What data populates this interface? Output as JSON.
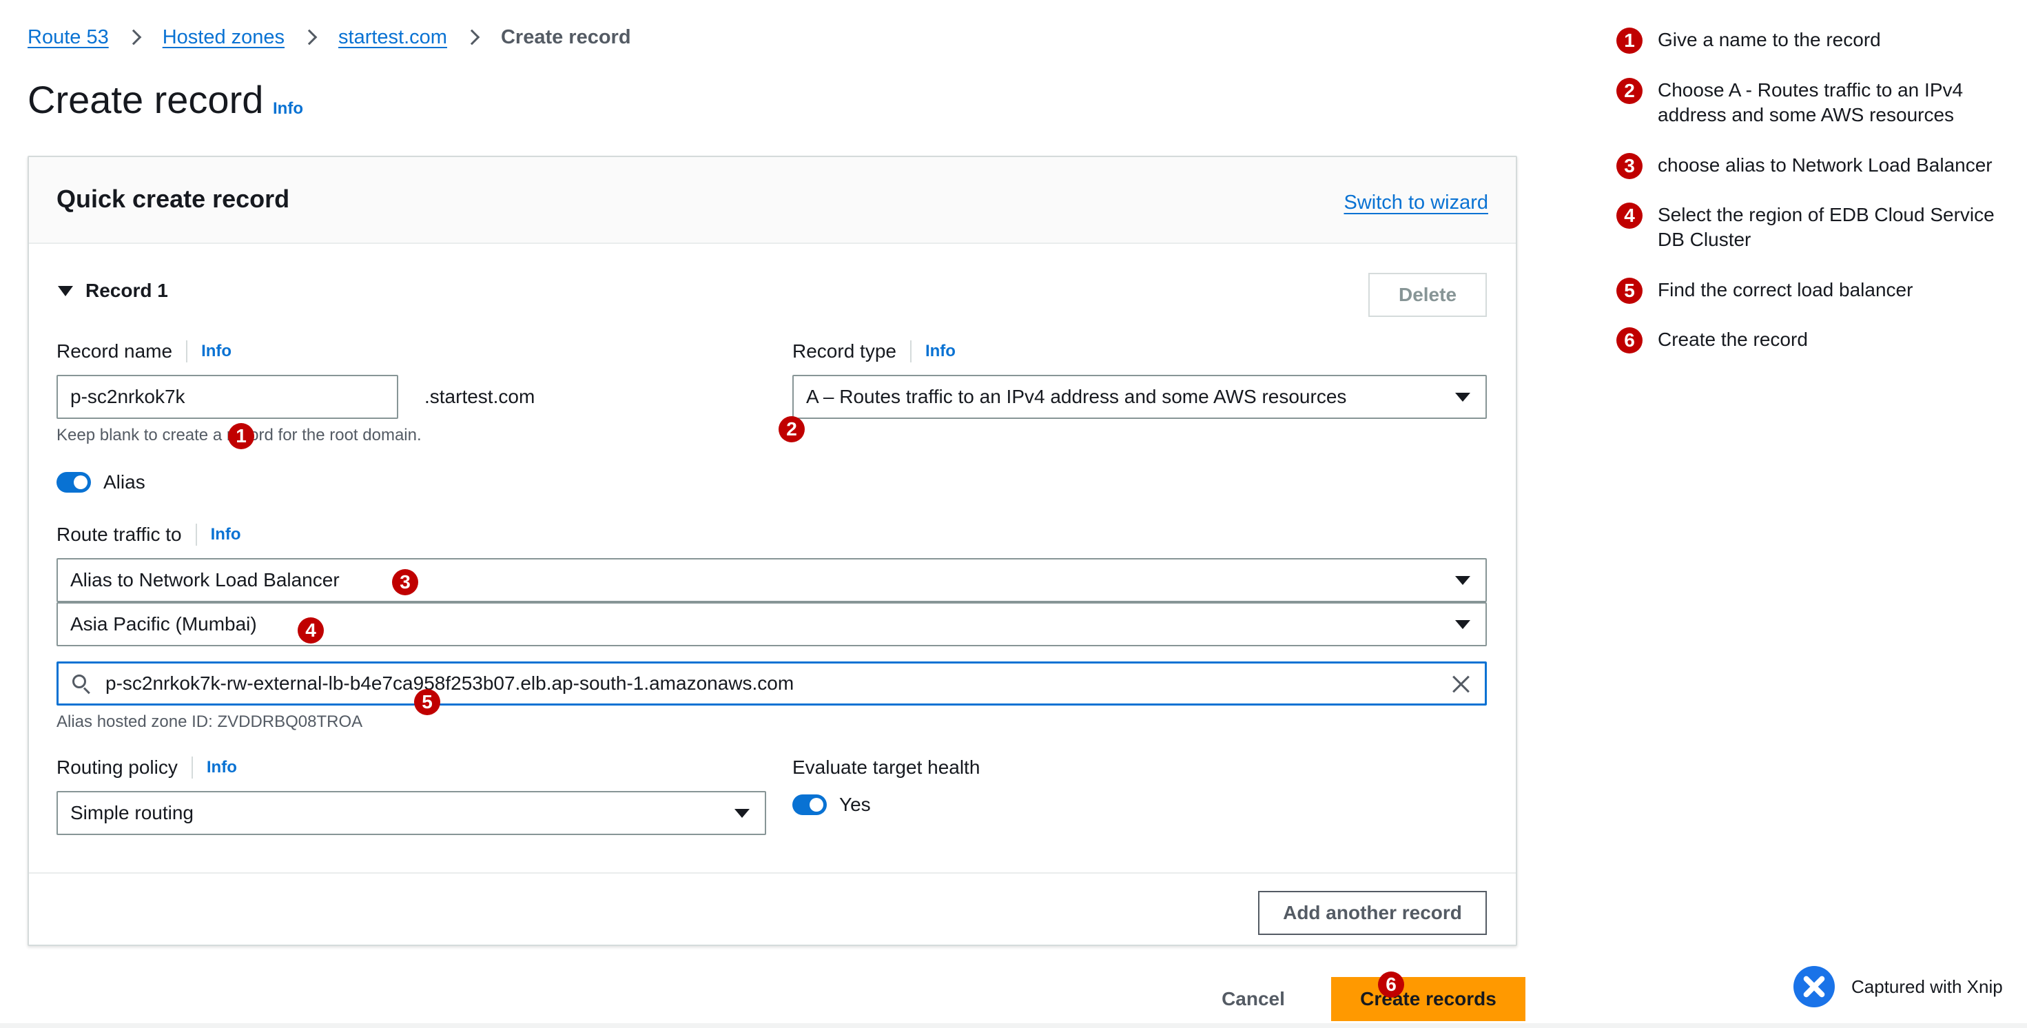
{
  "breadcrumb": {
    "items": [
      "Route 53",
      "Hosted zones",
      "startest.com"
    ],
    "current": "Create record"
  },
  "page": {
    "title": "Create record",
    "info": "Info"
  },
  "quick_create": {
    "title": "Quick create record",
    "switch_link": "Switch to wizard",
    "record_section": "Record 1",
    "delete_label": "Delete"
  },
  "record_name": {
    "label": "Record name",
    "info": "Info",
    "value": "p-sc2nrkok7k",
    "suffix": ".startest.com",
    "hint": "Keep blank to create a record for the root domain."
  },
  "record_type": {
    "label": "Record type",
    "info": "Info",
    "value": "A – Routes traffic to an IPv4 address and some AWS resources"
  },
  "alias": {
    "label": "Alias",
    "enabled": true
  },
  "route_traffic": {
    "label": "Route traffic to",
    "info": "Info",
    "endpoint": "Alias to Network Load Balancer",
    "region": "Asia Pacific (Mumbai)",
    "load_balancer": "p-sc2nrkok7k-rw-external-lb-b4e7ca958f253b07.elb.ap-south-1.amazonaws.com",
    "hosted_zone_hint": "Alias hosted zone ID: ZVDDRBQ08TROA"
  },
  "routing_policy": {
    "label": "Routing policy",
    "info": "Info",
    "value": "Simple routing"
  },
  "evaluate_health": {
    "label": "Evaluate target health",
    "toggle_label": "Yes",
    "enabled": true
  },
  "actions": {
    "add_another": "Add another record",
    "cancel": "Cancel",
    "create": "Create records"
  },
  "markers": [
    "1",
    "2",
    "3",
    "4",
    "5",
    "6"
  ],
  "steps": [
    {
      "num": "1",
      "text": "Give a name to the record"
    },
    {
      "num": "2",
      "text": "Choose A - Routes traffic to an IPv4 address and some AWS resources"
    },
    {
      "num": "3",
      "text": "choose alias to Network Load Balancer"
    },
    {
      "num": "4",
      "text": "Select the region of EDB Cloud Service DB Cluster"
    },
    {
      "num": "5",
      "text": "Find  the correct load balancer"
    },
    {
      "num": "6",
      "text": "Create the record"
    }
  ],
  "capture": {
    "text": "Captured with Xnip",
    "icon": "xnip-logo-icon"
  },
  "colors": {
    "link": "#0972d3",
    "primary_button": "#ff9900",
    "marker": "#c00000",
    "toggle": "#0972d3"
  }
}
